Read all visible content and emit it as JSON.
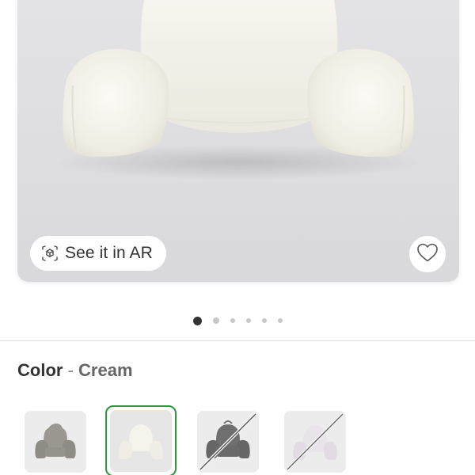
{
  "hero": {
    "ar_label": "See it in AR",
    "ar_icon": "ar-cube-icon",
    "favorite_icon": "heart-icon"
  },
  "carousel": {
    "total_images": 6,
    "active_index": 0
  },
  "color": {
    "label": "Color",
    "separator": "-",
    "selected": "Cream"
  },
  "swatches": [
    {
      "name": "gray",
      "available": true,
      "selected": false
    },
    {
      "name": "cream",
      "available": true,
      "selected": true
    },
    {
      "name": "charcoal",
      "available": false,
      "selected": false
    },
    {
      "name": "lavender",
      "available": false,
      "selected": false
    }
  ],
  "colors": {
    "accent_selected": "#2a9a3a",
    "text_primary": "#333333",
    "text_secondary": "#666666"
  }
}
